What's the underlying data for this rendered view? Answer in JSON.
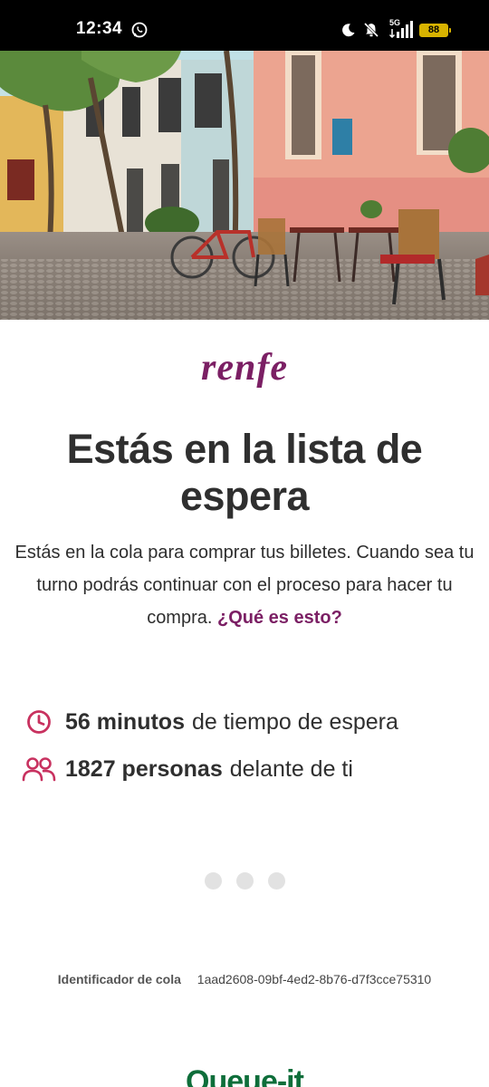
{
  "status_bar": {
    "time": "12:34",
    "network": "5G",
    "battery": "88",
    "icons": [
      "whatsapp-icon",
      "moon-icon",
      "bell-muted-icon",
      "signal-icon",
      "battery-icon"
    ]
  },
  "hero": {
    "icon": "street-photo"
  },
  "brand": {
    "logo_text": "renfe",
    "color": "#7b1f64"
  },
  "main": {
    "title": "Estás en la lista de espera",
    "description": "Estás en la cola para comprar tus billetes. Cuando sea tu turno podrás continuar con el proceso para hacer tu compra.",
    "help_link": "¿Qué es esto?"
  },
  "stats": {
    "wait": {
      "icon": "clock-icon",
      "value": "56 minutos",
      "label": "de tiempo de espera"
    },
    "people": {
      "icon": "people-icon",
      "value": "1827 personas",
      "label": "delante de ti"
    },
    "icon_color": "#c8315f"
  },
  "queue": {
    "id_label": "Identificador de cola",
    "id_value": "1aad2608-09bf-4ed2-8b76-d7f3cce75310"
  },
  "footer": {
    "logo_text": "Queue-it",
    "color": "#0e6e3a"
  }
}
